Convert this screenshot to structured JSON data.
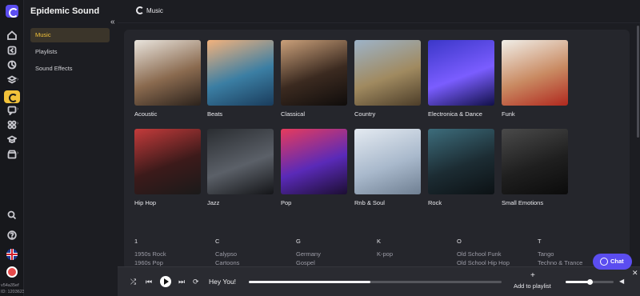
{
  "app": {
    "brand": "Epidemic Sound",
    "page_title": "Music",
    "collapse_glyph": "«",
    "version": "v54a35ef",
    "build_id": "ID: 1203623"
  },
  "sidenav": {
    "items": [
      {
        "label": "Music",
        "active": true
      },
      {
        "label": "Playlists",
        "active": false
      },
      {
        "label": "Sound Effects",
        "active": false
      }
    ]
  },
  "rail_icons": [
    "home-icon",
    "back-icon",
    "explore-icon",
    "layers-icon",
    "rocket-icon",
    "music-icon",
    "chat-bubble-icon",
    "puzzle-icon",
    "graduation-icon",
    "store-icon",
    "search-icon",
    "help-icon",
    "language-flag-icon",
    "user-avatar-icon"
  ],
  "genres": [
    {
      "label": "Acoustic",
      "colors": [
        "#e9e4dd",
        "#8a6a4f",
        "#2b221c"
      ]
    },
    {
      "label": "Beats",
      "colors": [
        "#f3b27c",
        "#3b7ea3",
        "#1a3c5c"
      ]
    },
    {
      "label": "Classical",
      "colors": [
        "#caa07a",
        "#3b2a20",
        "#0f0c0b"
      ]
    },
    {
      "label": "Country",
      "colors": [
        "#9db3c8",
        "#a08a60",
        "#4c3d29"
      ]
    },
    {
      "label": "Electronica & Dance",
      "colors": [
        "#3b37c8",
        "#7a5dff",
        "#111048"
      ]
    },
    {
      "label": "Funk",
      "colors": [
        "#f0eee8",
        "#c98a62",
        "#b0281e"
      ]
    },
    {
      "label": "Hip Hop",
      "colors": [
        "#c43b3b",
        "#3c1a1a",
        "#1a1a1a"
      ]
    },
    {
      "label": "Jazz",
      "colors": [
        "#2a2d31",
        "#5b6068",
        "#141518"
      ]
    },
    {
      "label": "Pop",
      "colors": [
        "#e73b5c",
        "#5a2ab8",
        "#1c0e32"
      ]
    },
    {
      "label": "Rnb & Soul",
      "colors": [
        "#e4eaf1",
        "#a9b9cc",
        "#6f7f92"
      ]
    },
    {
      "label": "Rock",
      "colors": [
        "#3d6d7c",
        "#1c2c33",
        "#0c1114"
      ]
    },
    {
      "label": "Small Emotions",
      "colors": [
        "#4a4a4a",
        "#1f1f1f",
        "#0b0b0b"
      ]
    }
  ],
  "alphabet": [
    {
      "letter": "1",
      "items": [
        "1950s Rock",
        "1960s Pop"
      ]
    },
    {
      "letter": "C",
      "items": [
        "Calypso",
        "Cartoons"
      ]
    },
    {
      "letter": "G",
      "items": [
        "Germany",
        "Gospel"
      ]
    },
    {
      "letter": "K",
      "items": [
        "K-pop"
      ]
    },
    {
      "letter": "O",
      "items": [
        "Old School Funk",
        "Old School Hip Hop"
      ]
    },
    {
      "letter": "T",
      "items": [
        "Tango",
        "Techno & Trance"
      ]
    }
  ],
  "player": {
    "track": "Hey You!",
    "progress": 0.48,
    "add_to_playlist_label": "Add to playlist",
    "add_glyph": "+",
    "volume": 0.5,
    "shuffle_glyph": "⤮",
    "prev_glyph": "⏮",
    "next_glyph": "⏭",
    "repeat_glyph": "⟳",
    "speaker_glyph": "◀"
  },
  "chat": {
    "label": "Chat",
    "close_glyph": "✕"
  }
}
